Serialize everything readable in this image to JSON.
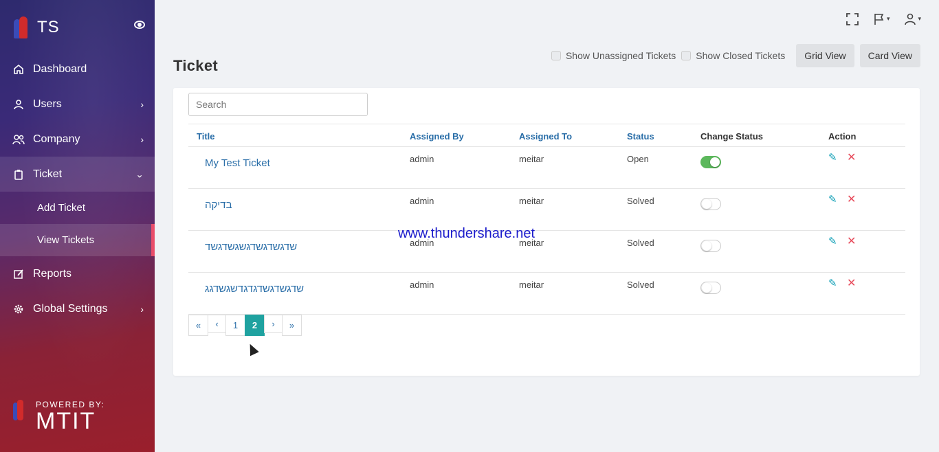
{
  "sidebar": {
    "brand": "TS",
    "items": [
      {
        "label": "Dashboard",
        "icon": "home-icon"
      },
      {
        "label": "Users",
        "icon": "user-icon"
      },
      {
        "label": "Company",
        "icon": "users-icon"
      },
      {
        "label": "Ticket",
        "icon": "clipboard-icon"
      },
      {
        "label": "Reports",
        "icon": "edit-icon"
      },
      {
        "label": "Global Settings",
        "icon": "gear-icon"
      }
    ],
    "ticket_sub": [
      "Add Ticket",
      "View Tickets"
    ],
    "powered_by": "POWERED BY:",
    "powered_brand": "MTIT"
  },
  "header": {
    "title": "Ticket",
    "show_unassigned": "Show Unassigned Tickets",
    "show_closed": "Show Closed Tickets",
    "grid_view": "Grid View",
    "card_view": "Card View"
  },
  "search": {
    "placeholder": "Search"
  },
  "table": {
    "columns": [
      "Title",
      "Assigned By",
      "Assigned To",
      "Status",
      "Change Status",
      "Action"
    ],
    "rows": [
      {
        "title": "My Test Ticket",
        "assigned_by": "admin",
        "assigned_to": "meitar",
        "status": "Open",
        "toggle": true
      },
      {
        "title": "בדיקה",
        "assigned_by": "admin",
        "assigned_to": "meitar",
        "status": "Solved",
        "toggle": false
      },
      {
        "title": "שדגשדגשדגשגשדגשד",
        "assigned_by": "admin",
        "assigned_to": "meitar",
        "status": "Solved",
        "toggle": false
      },
      {
        "title": "שדגשדגשדגדגדשגשדגג",
        "assigned_by": "admin",
        "assigned_to": "meitar",
        "status": "Solved",
        "toggle": false
      }
    ]
  },
  "pagination": {
    "first": "«",
    "prev": "‹",
    "page1": "1",
    "page2": "2",
    "next": "›",
    "last": "»"
  },
  "watermark": "www.thundershare.net",
  "colors": {
    "accent": "#1fa2a0",
    "link": "#2a6ea8",
    "danger": "#e74c5c"
  }
}
